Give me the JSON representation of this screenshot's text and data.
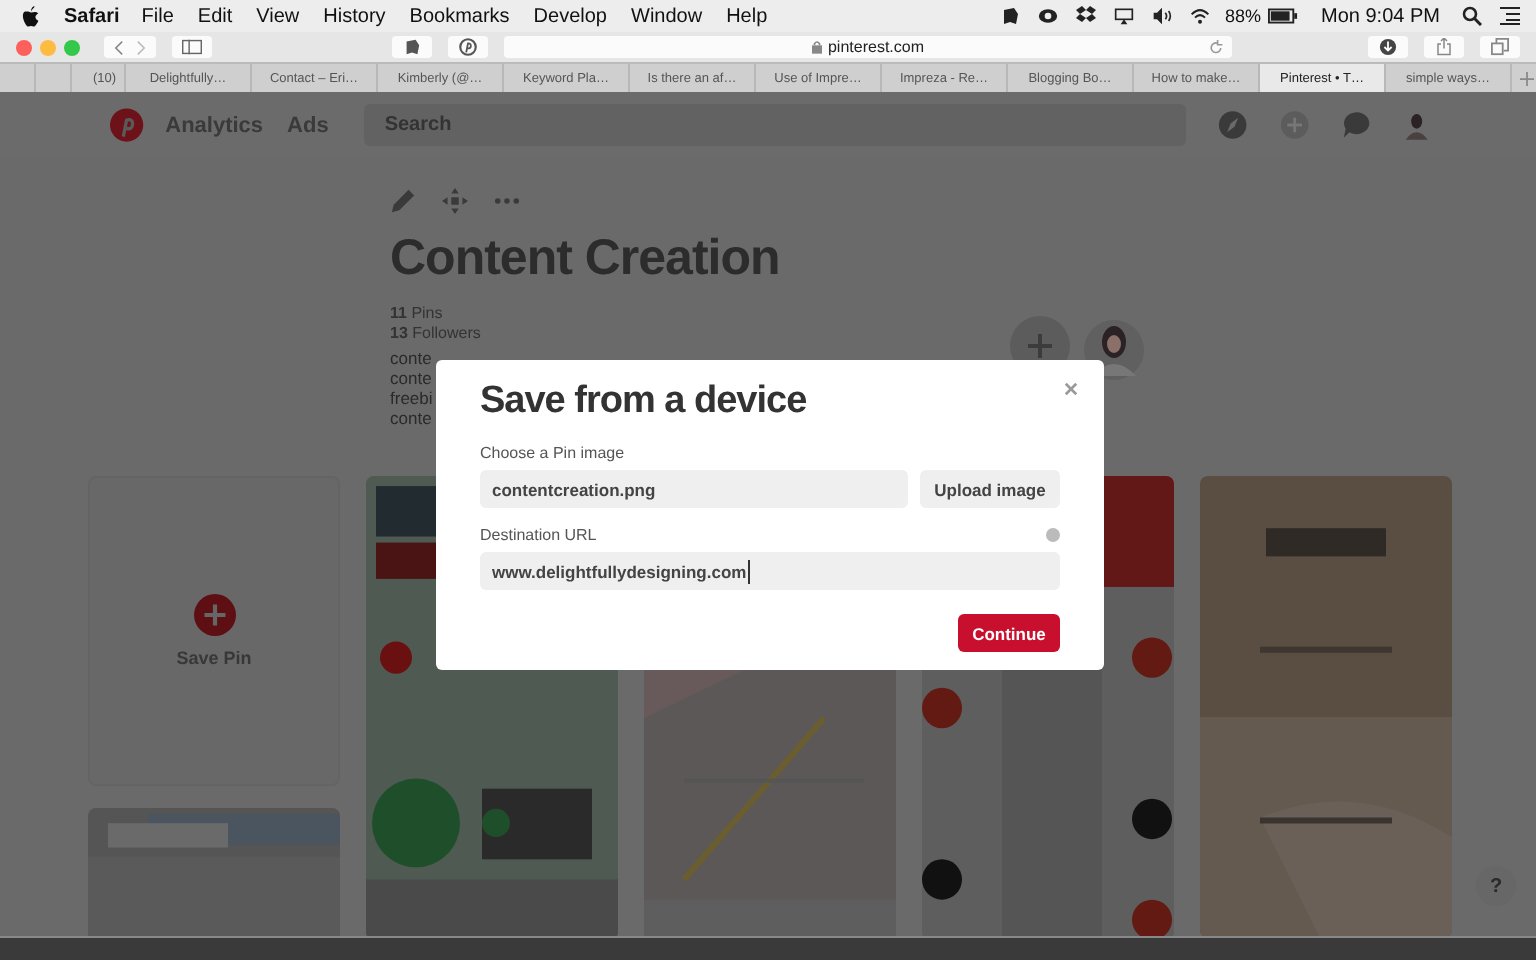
{
  "menu_bar": {
    "app": "Safari",
    "menus": [
      "File",
      "Edit",
      "View",
      "History",
      "Bookmarks",
      "Develop",
      "Window",
      "Help"
    ],
    "battery": "88%",
    "clock": "Mon 9:04 PM"
  },
  "toolbar": {
    "address": "pinterest.com"
  },
  "tabs": [
    {
      "label": "(10)",
      "selected": false
    },
    {
      "label": "Delightfully…",
      "selected": false
    },
    {
      "label": "Contact – Eri…",
      "selected": false
    },
    {
      "label": "Kimberly (@…",
      "selected": false
    },
    {
      "label": "Keyword Pla…",
      "selected": false
    },
    {
      "label": "Is there an af…",
      "selected": false
    },
    {
      "label": "Use of Impre…",
      "selected": false
    },
    {
      "label": "Impreza - Re…",
      "selected": false
    },
    {
      "label": "Blogging Bo…",
      "selected": false
    },
    {
      "label": "How to make…",
      "selected": false
    },
    {
      "label": "Pinterest • T…",
      "selected": true
    },
    {
      "label": "simple ways…",
      "selected": false
    }
  ],
  "header": {
    "nav": [
      "Analytics",
      "Ads"
    ],
    "search": {
      "placeholder": "Search"
    }
  },
  "board": {
    "title": "Content Creation",
    "stats": [
      "**11** Pins",
      "**13** Followers"
    ],
    "description": [
      "conte",
      "conte",
      "freebi",
      "conte"
    ]
  },
  "pin_columns": [
    [
      {
        "kind": "save",
        "label": "Save Pin"
      },
      {
        "kind": "picture"
      }
    ],
    [
      {
        "kind": "picture"
      }
    ],
    [
      {
        "kind": "picture"
      }
    ],
    [
      {
        "kind": "picture"
      }
    ],
    [
      {
        "kind": "picture"
      }
    ]
  ],
  "modal": {
    "title": "Save from a device",
    "image_label": "Choose a Pin image",
    "image_value": "contentcreation.png",
    "upload_button": "Upload image",
    "url_label": "Destination URL",
    "url_value": "www.delightfullydesigning.com",
    "continue_button": "Continue"
  },
  "help_button": "?"
}
